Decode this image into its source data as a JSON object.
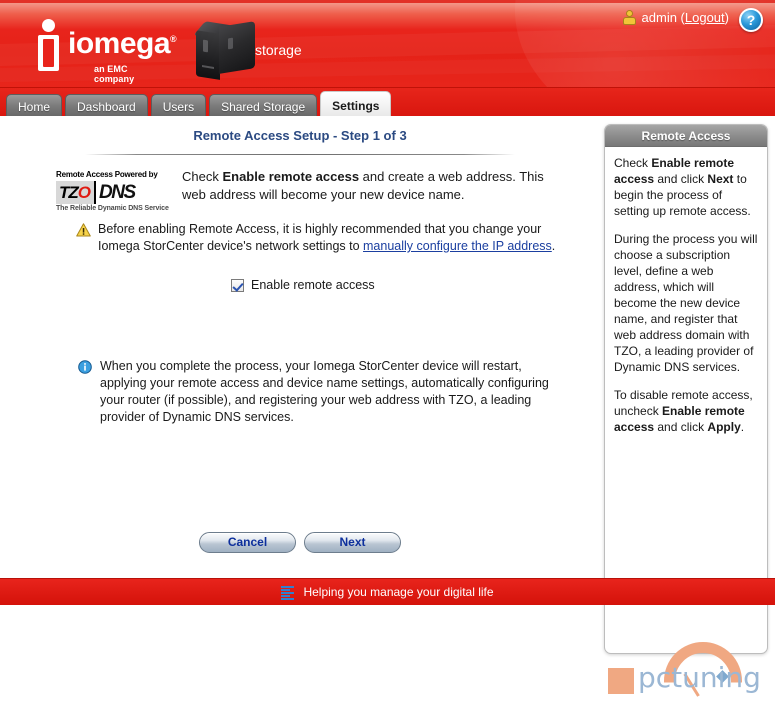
{
  "header": {
    "logo_word": "iomega",
    "logo_tm": "®",
    "logo_sub": "an EMC company",
    "device_label": "storage",
    "user_name": "admin (",
    "logout_label": "Logout",
    "user_suffix": ")",
    "help_label": "?",
    "user_icon": "user-icon",
    "help_icon": "help-icon",
    "device_icon": "nas-device-icon"
  },
  "tabs": [
    {
      "label": "Home",
      "active": false
    },
    {
      "label": "Dashboard",
      "active": false
    },
    {
      "label": "Users",
      "active": false
    },
    {
      "label": "Shared Storage",
      "active": false
    },
    {
      "label": "Settings",
      "active": true
    }
  ],
  "main": {
    "title": "Remote Access Setup - Step 1 of 3",
    "tzo_logo": {
      "top_line": "Remote Access Powered by",
      "mark_tz": "TZ",
      "mark_o": "O",
      "mark_dns": "DNS",
      "bottom_line": "The Reliable Dynamic DNS Service"
    },
    "intro_before": "Check ",
    "intro_bold": "Enable remote access",
    "intro_after": " and create a web address. This web address will become your new device name.",
    "warning_icon": "warning-triangle-icon",
    "warning_text_before": "Before enabling Remote Access, it is highly recommended that you change your Iomega StorCenter device's network settings to ",
    "warning_link": "manually configure the IP address",
    "warning_text_after": ".",
    "checkbox_label": "Enable remote access",
    "checkbox_checked": true,
    "info_icon": "info-circle-icon",
    "info_text": "When you complete the process, your Iomega StorCenter device will restart, applying your remote access and device name settings, automatically configuring your router (if possible), and registering your web address with TZO, a leading provider of Dynamic DNS services.",
    "cancel_label": "Cancel",
    "next_label": "Next"
  },
  "sidebar": {
    "title": "Remote Access",
    "para1_a": "Check ",
    "para1_b": "Enable remote access",
    "para1_c": " and click ",
    "para1_d": "Next",
    "para1_e": " to begin the process of setting up remote access.",
    "para2": "During the process you will choose a subscription level, define a web address, which will become the new device name, and register that web address domain with TZO, a leading provider of Dynamic DNS services.",
    "para3_a": "To disable remote access, uncheck ",
    "para3_b": "Enable remote access",
    "para3_c": " and click ",
    "para3_d": "Apply",
    "para3_e": "."
  },
  "watermark": {
    "text": "pctuning"
  },
  "footer": {
    "tagline": "Helping you manage your digital life",
    "logo_icon": "emc-bars-icon"
  },
  "colors": {
    "brand_red": "#e8241c",
    "title_blue": "#2b4a82",
    "link_blue": "#1b3fa0",
    "tab_gray": "#7b7b7b",
    "warning_yellow": "#f2c438",
    "info_blue": "#2b9ada"
  }
}
